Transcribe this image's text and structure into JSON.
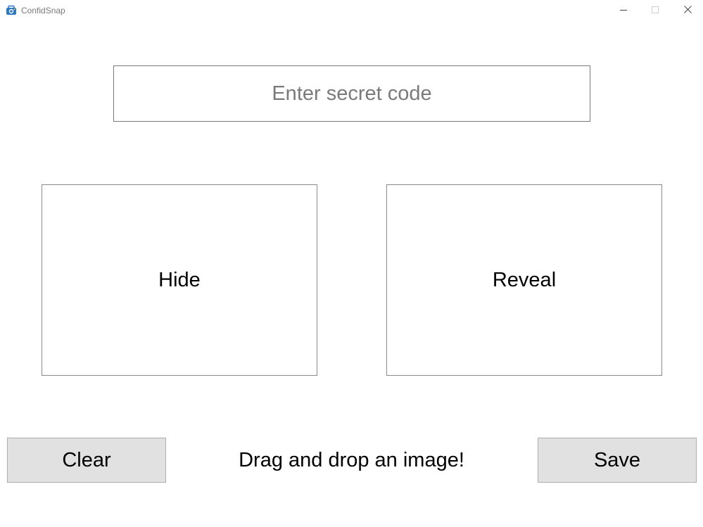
{
  "window": {
    "title": "ConfidSnap",
    "icon": "camera-lock-icon",
    "controls": {
      "minimize": "minimize-icon",
      "maximize": "maximize-icon",
      "close": "close-icon"
    }
  },
  "code_input": {
    "value": "",
    "placeholder": "Enter secret code"
  },
  "panels": {
    "hide_label": "Hide",
    "reveal_label": "Reveal"
  },
  "footer": {
    "clear_label": "Clear",
    "drop_hint": "Drag and drop an image!",
    "save_label": "Save"
  },
  "colors": {
    "button_bg": "#e1e1e1",
    "button_border": "#adadad",
    "panel_border": "#8a8a8a",
    "placeholder": "#7a7a7a",
    "icon_accent": "#2b78c5"
  }
}
